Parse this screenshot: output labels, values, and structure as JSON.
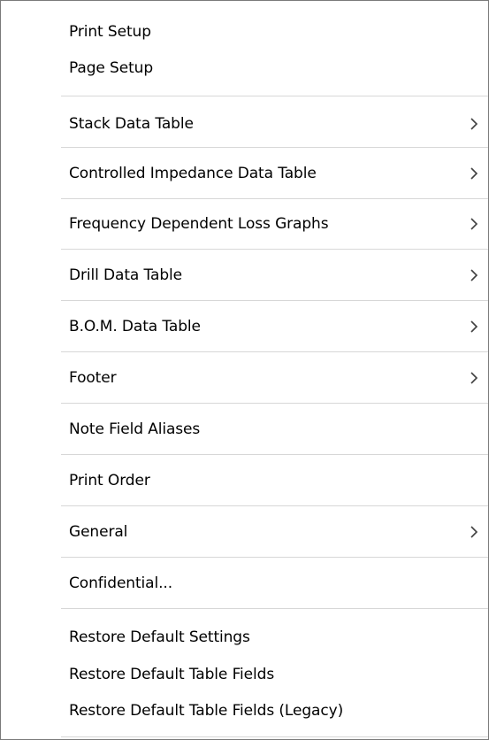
{
  "menu": {
    "items": [
      {
        "label": "Print Setup"
      },
      {
        "label": "Page Setup"
      },
      {
        "label": "Stack Data Table"
      },
      {
        "label": "Controlled Impedance Data Table"
      },
      {
        "label": "Frequency Dependent Loss Graphs"
      },
      {
        "label": "Drill Data Table"
      },
      {
        "label": "B.O.M. Data Table"
      },
      {
        "label": "Footer"
      },
      {
        "label": "Note Field Aliases"
      },
      {
        "label": "Print Order"
      },
      {
        "label": "General"
      },
      {
        "label": "Confidential..."
      },
      {
        "label": "Restore Default Settings"
      },
      {
        "label": "Restore Default Table Fields"
      },
      {
        "label": "Restore Default Table Fields (Legacy)"
      }
    ]
  },
  "icons": {
    "submenu": "chevron-right-icon"
  },
  "colors": {
    "background": "#ffffff",
    "border": "#7a7a7a",
    "separator": "#d7d7d7",
    "text": "#000000"
  }
}
